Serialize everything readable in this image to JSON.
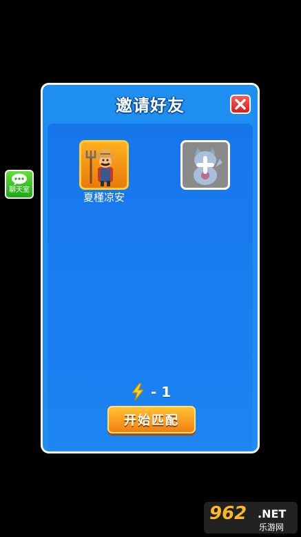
{
  "chat": {
    "label": "聊天室"
  },
  "dialog": {
    "title": "邀请好友",
    "close_icon": "close-icon",
    "slots": [
      {
        "type": "player",
        "name": "夏槿凉安"
      },
      {
        "type": "empty-invite"
      }
    ],
    "energy": {
      "icon": "lightning-icon",
      "cost": "- 1"
    },
    "start_button": "开始匹配"
  },
  "watermark": {
    "logo": "962",
    "net": ".NET",
    "sub": "乐游网"
  },
  "colors": {
    "background": "#000000",
    "dialog_blue": "#1e8ef0",
    "panel_blue": "#1677ec",
    "button_orange": "#f07f12",
    "close_red": "#d81e1e",
    "chat_green": "#1fa814"
  }
}
